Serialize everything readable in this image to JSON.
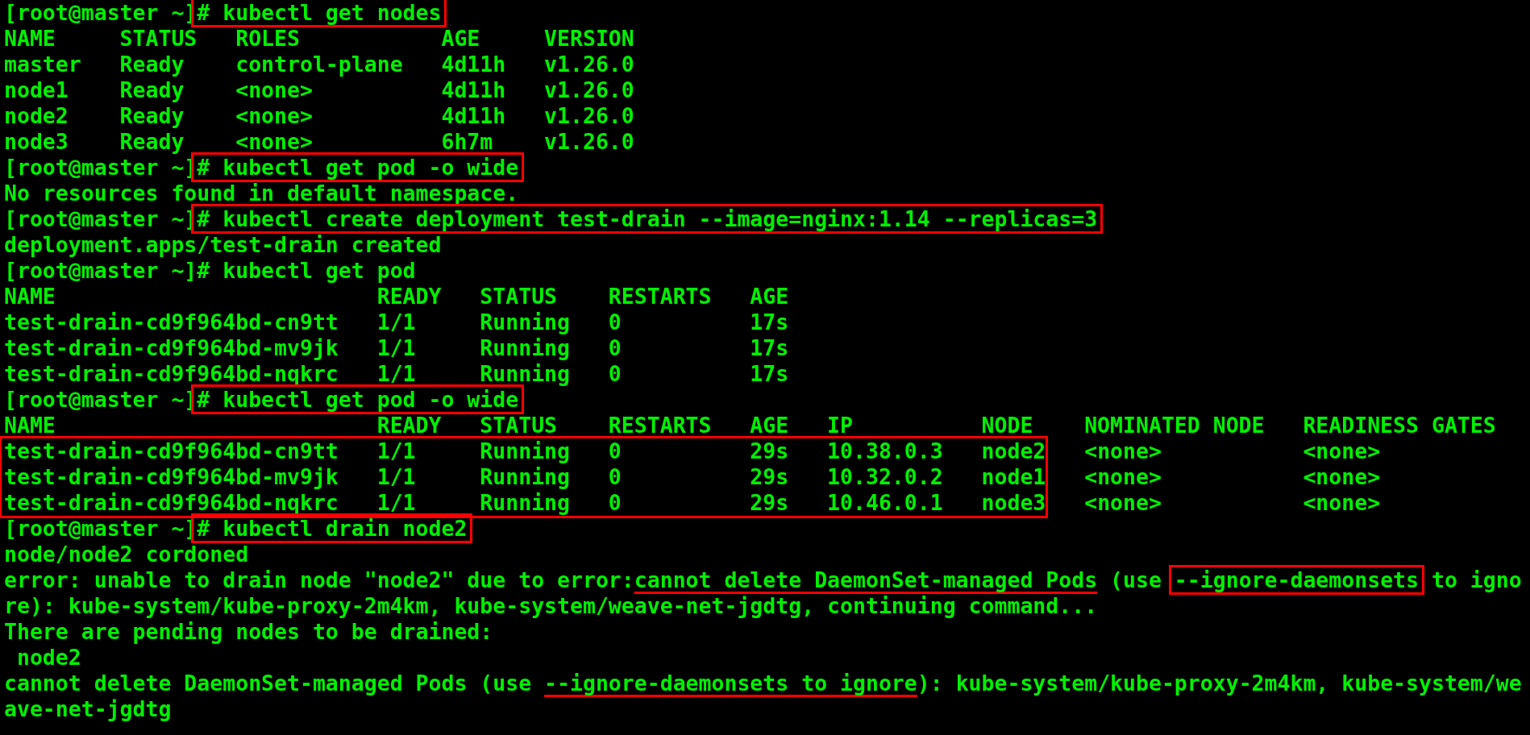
{
  "terminal": {
    "lines": [
      {
        "kind": "line",
        "segments": [
          {
            "text": "[root@master ~]",
            "boxed": false,
            "underlined": false
          },
          {
            "text": "# kubectl get nodes",
            "boxed": true,
            "underlined": false
          }
        ]
      },
      {
        "kind": "line",
        "segments": [
          {
            "text": "NAME     STATUS   ROLES           AGE     VERSION",
            "boxed": false,
            "underlined": false
          }
        ]
      },
      {
        "kind": "line",
        "segments": [
          {
            "text": "master   Ready    control-plane   4d11h   v1.26.0",
            "boxed": false,
            "underlined": false
          }
        ]
      },
      {
        "kind": "line",
        "segments": [
          {
            "text": "node1    Ready    <none>          4d11h   v1.26.0",
            "boxed": false,
            "underlined": false
          }
        ]
      },
      {
        "kind": "line",
        "segments": [
          {
            "text": "node2    Ready    <none>          4d11h   v1.26.0",
            "boxed": false,
            "underlined": false
          }
        ]
      },
      {
        "kind": "line",
        "segments": [
          {
            "text": "node3    Ready    <none>          6h7m    v1.26.0",
            "boxed": false,
            "underlined": false
          }
        ]
      },
      {
        "kind": "line",
        "segments": [
          {
            "text": "[root@master ~]",
            "boxed": false,
            "underlined": false
          },
          {
            "text": "# kubectl get pod -o wide",
            "boxed": true,
            "underlined": false
          }
        ]
      },
      {
        "kind": "line",
        "segments": [
          {
            "text": "No resources found in default namespace.",
            "boxed": false,
            "underlined": false
          }
        ]
      },
      {
        "kind": "line",
        "segments": [
          {
            "text": "[root@master ~]",
            "boxed": false,
            "underlined": false
          },
          {
            "text": "# kubectl create deployment test-drain --image=nginx:1.14 --replicas=3",
            "boxed": true,
            "underlined": false
          }
        ]
      },
      {
        "kind": "line",
        "segments": [
          {
            "text": "deployment.apps/test-drain created",
            "boxed": false,
            "underlined": false
          }
        ]
      },
      {
        "kind": "line",
        "segments": [
          {
            "text": "[root@master ~]# kubectl get pod",
            "boxed": false,
            "underlined": false
          }
        ]
      },
      {
        "kind": "line",
        "segments": [
          {
            "text": "NAME                         READY   STATUS    RESTARTS   AGE",
            "boxed": false,
            "underlined": false
          }
        ]
      },
      {
        "kind": "line",
        "segments": [
          {
            "text": "test-drain-cd9f964bd-cn9tt   1/1     Running   0          17s",
            "boxed": false,
            "underlined": false
          }
        ]
      },
      {
        "kind": "line",
        "segments": [
          {
            "text": "test-drain-cd9f964bd-mv9jk   1/1     Running   0          17s",
            "boxed": false,
            "underlined": false
          }
        ]
      },
      {
        "kind": "line",
        "segments": [
          {
            "text": "test-drain-cd9f964bd-nqkrc   1/1     Running   0          17s",
            "boxed": false,
            "underlined": false
          }
        ]
      },
      {
        "kind": "line",
        "segments": [
          {
            "text": "[root@master ~]",
            "boxed": false,
            "underlined": false
          },
          {
            "text": "# kubectl get pod -o wide",
            "boxed": true,
            "underlined": false
          }
        ]
      },
      {
        "kind": "line",
        "segments": [
          {
            "text": "NAME                         READY   STATUS    RESTARTS   AGE   IP          NODE    NOMINATED NODE   READINESS GATES",
            "boxed": false,
            "underlined": false
          }
        ]
      },
      {
        "kind": "boxed_rows",
        "rows": [
          {
            "boxed": "test-drain-cd9f964bd-cn9tt   1/1     Running   0          29s   10.38.0.3   node2",
            "rest": "   <none>           <none>"
          },
          {
            "boxed": "test-drain-cd9f964bd-mv9jk   1/1     Running   0          29s   10.32.0.2   node1",
            "rest": "   <none>           <none>"
          },
          {
            "boxed": "test-drain-cd9f964bd-nqkrc   1/1     Running   0          29s   10.46.0.1   node3",
            "rest": "   <none>           <none>"
          }
        ]
      },
      {
        "kind": "line",
        "segments": [
          {
            "text": "[root@master ~]",
            "boxed": false,
            "underlined": false
          },
          {
            "text": "# kubectl drain node2",
            "boxed": true,
            "underlined": false
          }
        ]
      },
      {
        "kind": "line",
        "segments": [
          {
            "text": "node/node2 cordoned",
            "boxed": false,
            "underlined": false
          }
        ]
      },
      {
        "kind": "line",
        "segments": [
          {
            "text": "error: unable to drain node \"node2\" due to error:",
            "boxed": false,
            "underlined": false
          },
          {
            "text": "cannot delete DaemonSet-managed Pods",
            "boxed": false,
            "underlined": true
          },
          {
            "text": " (use ",
            "boxed": false,
            "underlined": false
          },
          {
            "text": "--ignore-daemonsets",
            "boxed": true,
            "underlined": false
          },
          {
            "text": " to igno",
            "boxed": false,
            "underlined": false
          }
        ]
      },
      {
        "kind": "line",
        "segments": [
          {
            "text": "re): kube-system/kube-proxy-2m4km, kube-system/weave-net-jgdtg, continuing command...",
            "boxed": false,
            "underlined": false
          }
        ]
      },
      {
        "kind": "line",
        "segments": [
          {
            "text": "There are pending nodes to be drained:",
            "boxed": false,
            "underlined": false
          }
        ]
      },
      {
        "kind": "line",
        "segments": [
          {
            "text": " node2",
            "boxed": false,
            "underlined": false
          }
        ]
      },
      {
        "kind": "line",
        "segments": [
          {
            "text": "cannot delete DaemonSet-managed Pods (use ",
            "boxed": false,
            "underlined": false
          },
          {
            "text": "--ignore-daemonsets to ignore",
            "boxed": false,
            "underlined": true
          },
          {
            "text": "): kube-system/kube-proxy-2m4km, kube-system/we",
            "boxed": false,
            "underlined": false
          }
        ]
      },
      {
        "kind": "line",
        "segments": [
          {
            "text": "ave-net-jgdtg",
            "boxed": false,
            "underlined": false
          }
        ]
      }
    ]
  }
}
